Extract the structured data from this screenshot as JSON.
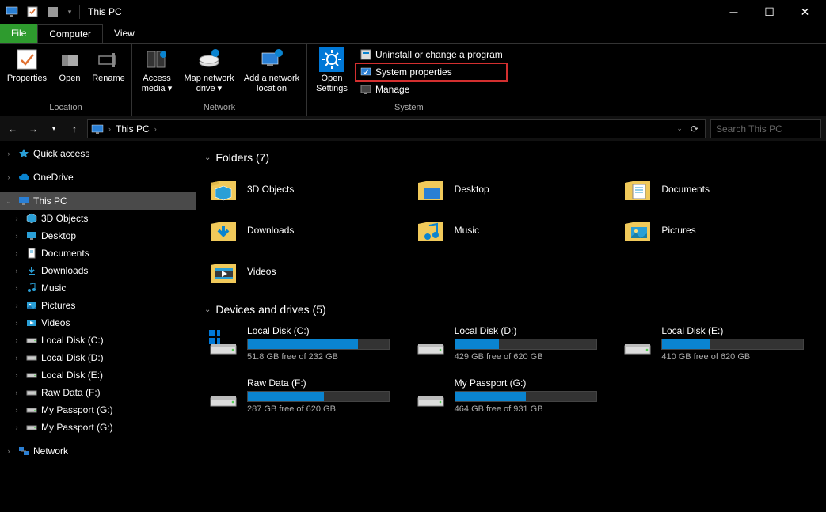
{
  "title": "This PC",
  "tabs": {
    "file": "File",
    "computer": "Computer",
    "view": "View"
  },
  "ribbon": {
    "location": {
      "properties": "Properties",
      "open": "Open",
      "rename": "Rename",
      "label": "Location"
    },
    "network": {
      "access_media": "Access media",
      "map_drive": "Map network drive",
      "add_loc": "Add a network location",
      "label": "Network"
    },
    "settings": {
      "open_settings": "Open Settings"
    },
    "system": {
      "uninstall": "Uninstall or change a program",
      "sys_props": "System properties",
      "manage": "Manage",
      "label": "System"
    }
  },
  "breadcrumb": {
    "current": "This PC"
  },
  "search": {
    "placeholder": "Search This PC"
  },
  "sidebar": {
    "quick": "Quick access",
    "onedrive": "OneDrive",
    "thispc": "This PC",
    "children": [
      "3D Objects",
      "Desktop",
      "Documents",
      "Downloads",
      "Music",
      "Pictures",
      "Videos",
      "Local Disk (C:)",
      "Local Disk (D:)",
      "Local Disk (E:)",
      "Raw Data (F:)",
      "My Passport (G:)",
      "My Passport (G:)"
    ],
    "network": "Network"
  },
  "content": {
    "folders_header": "Folders (7)",
    "folders": [
      "3D Objects",
      "Desktop",
      "Documents",
      "Downloads",
      "Music",
      "Pictures",
      "Videos"
    ],
    "drives_header": "Devices and drives (5)",
    "drives": [
      {
        "name": "Local Disk (C:)",
        "free": "51.8 GB free of 232 GB",
        "pct": 78
      },
      {
        "name": "Local Disk (D:)",
        "free": "429 GB free of 620 GB",
        "pct": 31
      },
      {
        "name": "Local Disk (E:)",
        "free": "410 GB free of 620 GB",
        "pct": 34
      },
      {
        "name": "Raw Data (F:)",
        "free": "287 GB free of 620 GB",
        "pct": 54
      },
      {
        "name": "My Passport (G:)",
        "free": "464 GB free of 931 GB",
        "pct": 50
      }
    ]
  }
}
